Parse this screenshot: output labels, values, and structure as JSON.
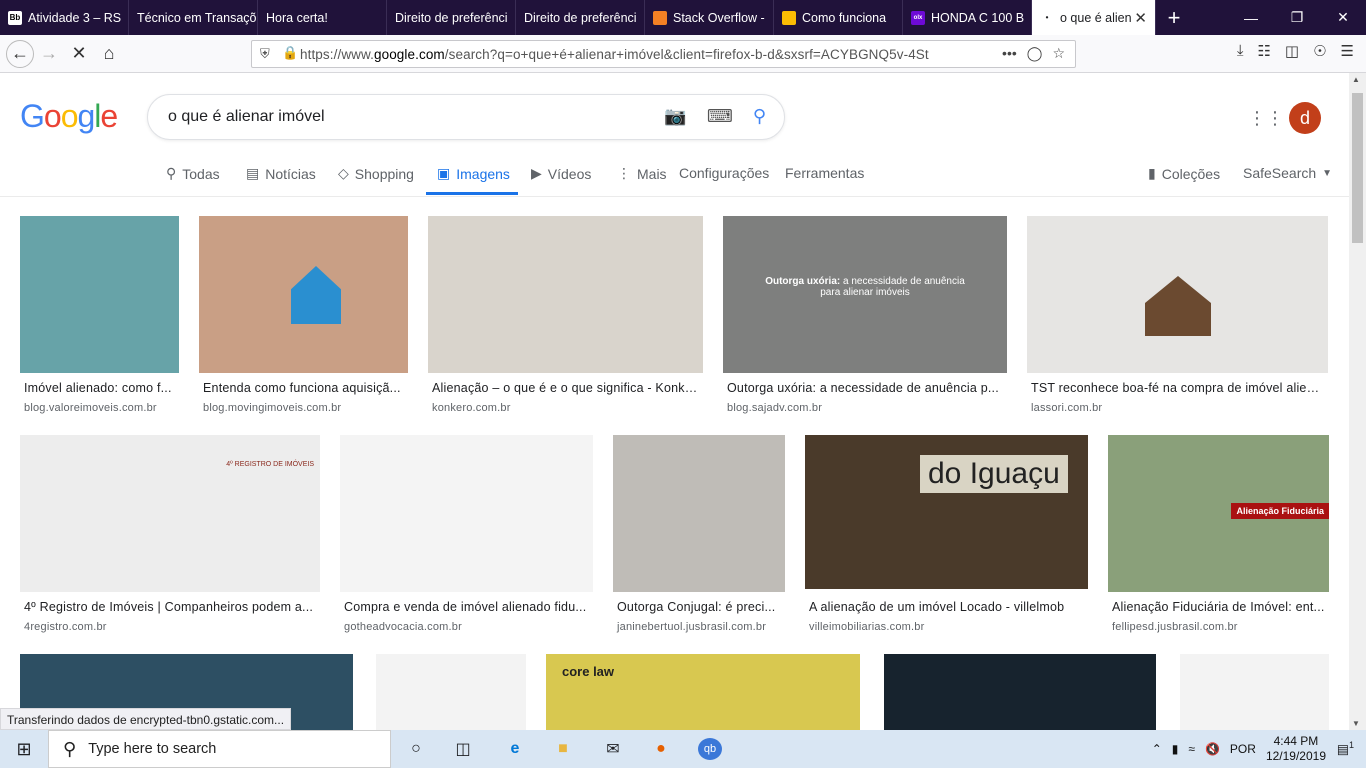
{
  "browser": {
    "tabs": [
      {
        "label": "Atividade 3 – RS",
        "icon": "bb-icon",
        "color": "#ffffff"
      },
      {
        "label": "Técnico em Transaçõ",
        "icon": "none",
        "color": "#20123a"
      },
      {
        "label": "Hora certa!",
        "icon": "none",
        "color": "#20123a"
      },
      {
        "label": "Direito de preferênci",
        "icon": "none",
        "color": "#20123a"
      },
      {
        "label": "Direito de preferênci",
        "icon": "none",
        "color": "#20123a"
      },
      {
        "label": "Stack Overflow -",
        "icon": "stack-overflow-icon",
        "color": "#f48024"
      },
      {
        "label": "Como funciona",
        "icon": "google-ads-icon",
        "color": "#fbbc04"
      },
      {
        "label": "HONDA C 100 B",
        "icon": "olx-icon",
        "color": "#6e0ad6"
      },
      {
        "label": "o que é alien",
        "icon": "google-icon",
        "color": "#ffffff",
        "active": true
      }
    ],
    "url_prefix": "https://www.",
    "url_host": "google.com",
    "url_rest": "/search?q=o+que+é+alienar+imóvel&client=firefox-b-d&sxsrf=ACYBGNQ5v-4St"
  },
  "google": {
    "logo": "Google",
    "query": "o que é alienar imóvel",
    "avatar_letter": "d",
    "nav": [
      {
        "label": "Todas",
        "icon": "search-icon"
      },
      {
        "label": "Notícias",
        "icon": "news-icon"
      },
      {
        "label": "Shopping",
        "icon": "tag-icon"
      },
      {
        "label": "Imagens",
        "icon": "image-icon",
        "active": true
      },
      {
        "label": "Vídeos",
        "icon": "play-icon"
      },
      {
        "label": "Mais",
        "icon": "more-icon"
      },
      {
        "label": "Configurações",
        "icon": "none"
      },
      {
        "label": "Ferramentas",
        "icon": "none"
      }
    ],
    "collections": "Coleções",
    "safesearch": "SafeSearch"
  },
  "results": [
    {
      "caption": "Imóvel alienado: como f...",
      "domain": "blog.valoreimoveis.com.br",
      "bg": "#67a3a8"
    },
    {
      "caption": "Entenda como funciona aquisiçã...",
      "domain": "blog.movingimoveis.com.br",
      "bg": "#c99f85"
    },
    {
      "caption": "Alienação – o que é e o que significa - Konkero",
      "domain": "konkero.com.br",
      "bg": "#d9d4cc"
    },
    {
      "caption": "Outorga uxória: a necessidade de anuência p...",
      "domain": "blog.sajadv.com.br",
      "bg": "#7e7f7e",
      "overlay_bold": "Outorga uxória:",
      "overlay_text": "a necessidade de anuência para alienar imóveis"
    },
    {
      "caption": "TST reconhece boa-fé na compra de imóvel alien...",
      "domain": "lassori.com.br",
      "bg": "#e6e5e3"
    },
    {
      "caption": "4º Registro de Imóveis | Companheiros podem a...",
      "domain": "4registro.com.br",
      "bg": "#ededed",
      "overlay_text": "4º REGISTRO DE IMÓVEIS"
    },
    {
      "caption": "Compra e venda de imóvel alienado fidu...",
      "domain": "gotheadvocacia.com.br",
      "bg": "#f4f4f4"
    },
    {
      "caption": "Outorga Conjugal: é preci...",
      "domain": "janinebertuol.jusbrasil.com.br",
      "bg": "#bfbcb7"
    },
    {
      "caption": "A alienação de um imóvel Locado - villelmob",
      "domain": "villeimobiliarias.com.br",
      "bg": "#4a3a2a",
      "overlay_text": "do Iguaçu"
    },
    {
      "caption": "Alienação Fiduciária de Imóvel: ent...",
      "domain": "fellipesd.jusbrasil.com.br",
      "bg": "#8aa07a",
      "overlay_text": "Alienação Fiduciária"
    },
    {
      "bg": "#2d4f63"
    },
    {
      "bg": "#f3f3f3"
    },
    {
      "bg": "#d8c850",
      "overlay_text": "core law"
    },
    {
      "bg": "#17232e"
    },
    {
      "bg": "#f3f3f3"
    }
  ],
  "status_text": "Transferindo dados de encrypted-tbn0.gstatic.com...",
  "taskbar": {
    "search_placeholder": "Type here to search",
    "lang": "POR",
    "time": "4:44 PM",
    "date": "12/19/2019",
    "notifications": "1"
  }
}
